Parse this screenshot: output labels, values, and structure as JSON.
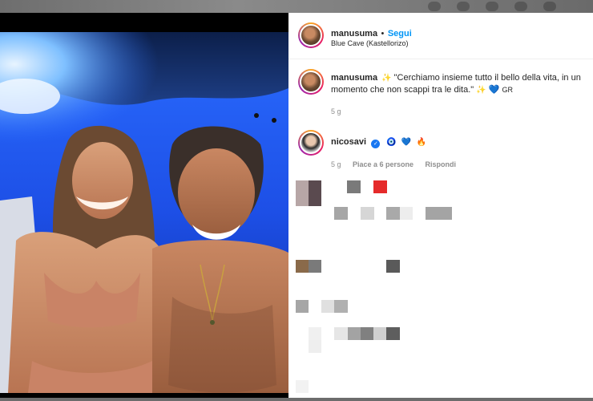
{
  "post": {
    "author": "manusuma",
    "separator": "•",
    "follow_label": "Segui",
    "location": "Blue Cave (Kastellorizo)"
  },
  "caption": {
    "author": "manusuma",
    "sparkle": "✨",
    "text": "\"Cerchiamo insieme tutto il bello della vita, in un momento che non scappi tra le dita.\"",
    "sparkle_end": "✨",
    "heart": "💙",
    "signature": "GR",
    "time": "5 g"
  },
  "comment": {
    "author": "nicosavi",
    "verified_mark": "✓",
    "emoji_ring": "🧿",
    "emoji_heart": "💙",
    "emoji_fire": "🔥",
    "time": "5 g",
    "likes_label": "Piace a 6 persone",
    "reply_label": "Rispondi"
  },
  "colors": {
    "follow": "#0095f6",
    "text": "#262626",
    "muted": "#8e8e8e",
    "cave_blue": "#1f5cff"
  }
}
